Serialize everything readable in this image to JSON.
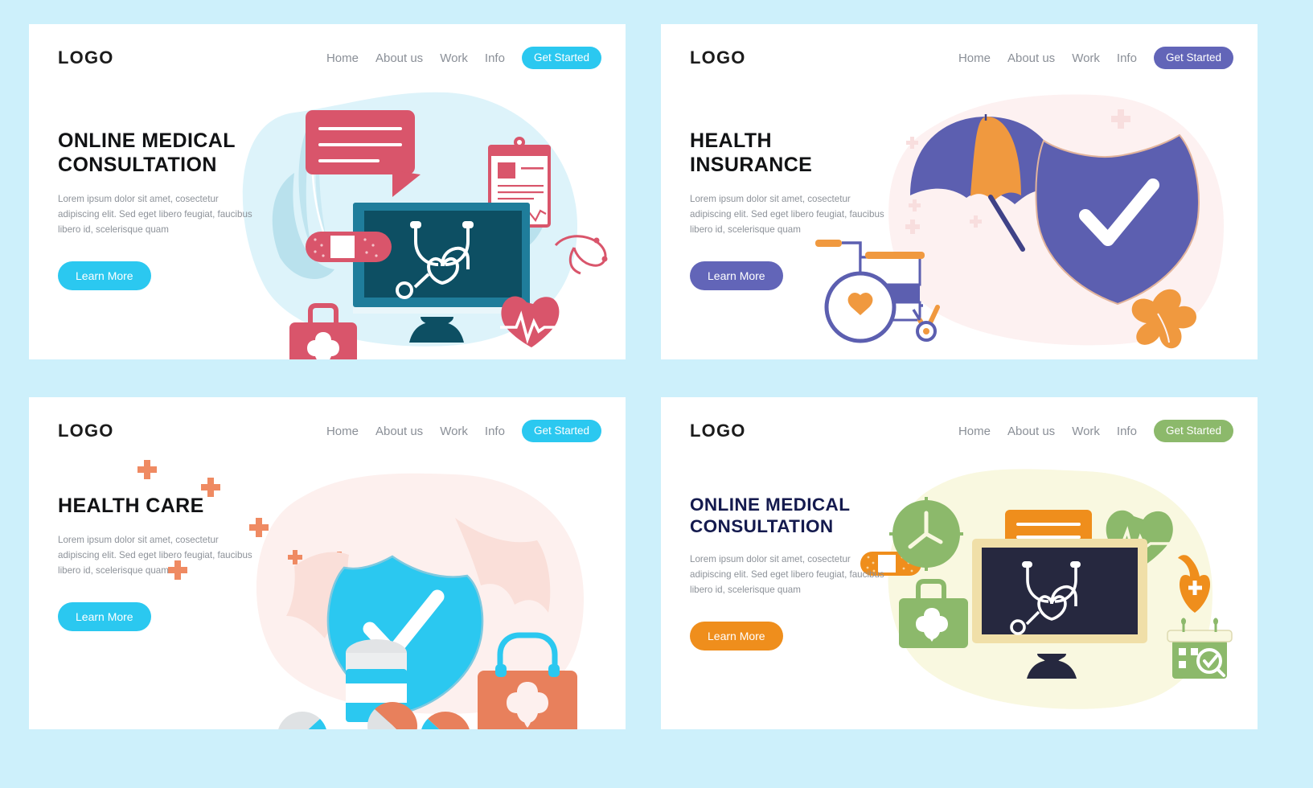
{
  "page": {
    "background_color": "#cdf0fb",
    "layout": "2x2 grid of landing page hero cards"
  },
  "shared": {
    "logo": "LOGO",
    "nav_links": [
      "Home",
      "About us",
      "Work",
      "Info"
    ],
    "get_started_label": "Get Started",
    "learn_more_label": "Learn More",
    "body_copy": "Lorem ipsum dolor sit amet, cosectetur adipiscing elit. Sed eget libero feugiat, faucibus libero id, scelerisque quam"
  },
  "cards": [
    {
      "id": "card-1",
      "headline_line1": "ONLINE MEDICAL",
      "headline_line2": "CONSULTATION",
      "accent_color": "#2bc8f0",
      "secondary_color": "#d9556b",
      "blob_color": "#ddf3fa",
      "screen_color": "#0d4f63",
      "art_items": [
        "speech-bubble",
        "clipboard",
        "monitor",
        "stethoscope",
        "bandage",
        "first-aid-kit",
        "heart-pulse",
        "dna-squiggle"
      ]
    },
    {
      "id": "card-2",
      "headline_line1": "HEALTH",
      "headline_line2": "INSURANCE",
      "accent_color": "#6265b8",
      "secondary_color": "#f0993f",
      "blob_color": "#fdf1f1",
      "art_items": [
        "umbrella",
        "wheelchair",
        "shield-check",
        "leaf",
        "plus-sparkle"
      ]
    },
    {
      "id": "card-3",
      "headline_line1": "HEALTH CARE",
      "headline_line2": "",
      "accent_color": "#2bc8f0",
      "secondary_color": "#e8805c",
      "blob_color": "#fdf0ee",
      "art_items": [
        "shield-check",
        "pill-bottle",
        "capsules",
        "first-aid-kit",
        "plus-sparkle",
        "leaf"
      ]
    },
    {
      "id": "card-4",
      "headline_line1": "ONLINE MEDICAL",
      "headline_line2": "CONSULTATION",
      "accent_color": "#ef8e1c",
      "secondary_color": "#8cb96b",
      "blob_color": "#f9f8e0",
      "screen_color": "#26283f",
      "art_items": [
        "monitor",
        "stethoscope",
        "speech-bubble",
        "clock",
        "heart-pulse",
        "first-aid-kit",
        "bandage",
        "calendar",
        "shield-cross"
      ]
    }
  ]
}
